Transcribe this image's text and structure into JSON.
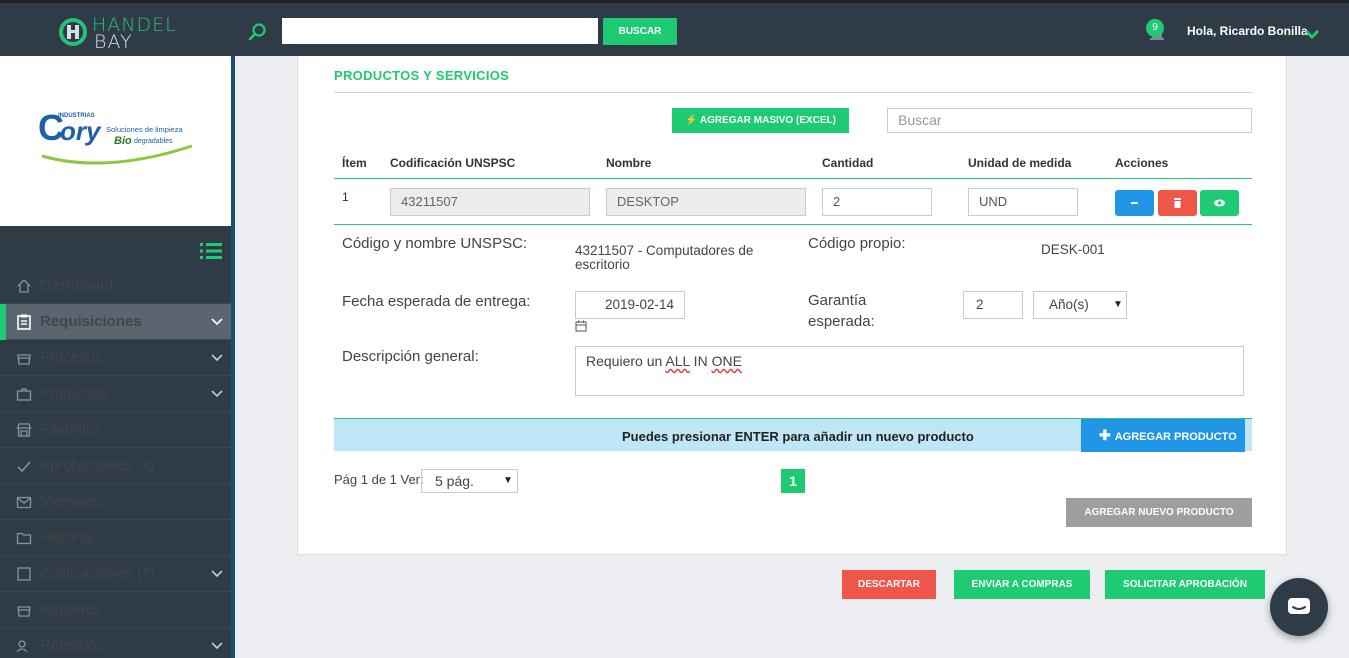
{
  "header": {
    "logo_line1": "HANDEL",
    "logo_line2": "BAY",
    "search_value": "",
    "search_button": "BUSCAR",
    "notification_count": "9",
    "greeting": "Hola, Ricardo Bonilla"
  },
  "company_logo": {
    "word": "ory",
    "letter": "C",
    "top": "INDUSTRIAS",
    "tag1": "Soluciones de limpieza",
    "tag2_a": "Bio",
    "tag2_b": "degradables"
  },
  "sidebar": {
    "items": [
      {
        "label": "Dashboard",
        "icon": "home-icon"
      },
      {
        "label": "Requisiciones",
        "icon": "clipboard-icon",
        "active": true
      },
      {
        "label": "Procesos",
        "icon": "inbox-icon"
      },
      {
        "label": "Productos",
        "icon": "briefcase-icon"
      },
      {
        "label": "Favoritos",
        "icon": "store-icon"
      },
      {
        "label": "Aprobaciones (3)",
        "icon": "check-icon"
      },
      {
        "label": "Mensajes",
        "icon": "envelope-icon"
      },
      {
        "label": "Historial",
        "icon": "folder-icon"
      },
      {
        "label": "Calificaciones (7)",
        "icon": "square-icon"
      },
      {
        "label": "Reportes",
        "icon": "inbox-icon"
      },
      {
        "label": "Referidos",
        "icon": "users-icon"
      }
    ]
  },
  "products": {
    "title": "PRODUCTOS Y SERVICIOS",
    "excel_button": "AGREGAR MASIVO (EXCEL)",
    "search_placeholder": "Buscar",
    "columns": [
      "Ítem",
      "Codificación UNSPSC",
      "Nombre",
      "Cantidad",
      "Unidad de medida",
      "Acciones"
    ],
    "row": {
      "item": "1",
      "unspsc": "43211507",
      "name": "DESKTOP",
      "quantity": "2",
      "unit": "UND"
    },
    "detail": {
      "unspsc_label": "Código y nombre UNSPSC:",
      "unspsc_value_1": "43211507 - Computadores de",
      "unspsc_value_2": "escritorio",
      "own_code_label": "Código propio:",
      "own_code_value": "DESK-001",
      "delivery_label": "Fecha esperada de entrega:",
      "delivery_value": "2019-02-14",
      "warranty_label_1": "Garantía",
      "warranty_label_2": "esperada:",
      "warranty_value": "2",
      "warranty_unit": "Año(s)",
      "description_label": "Descripción general:",
      "description_prefix": "Requiero un ",
      "description_w1": "ALL",
      "description_mid": " IN ",
      "description_w2": "ONE"
    },
    "info_text": "Puedes presionar ENTER para añadir un nuevo producto",
    "add_product_button": "AGREGAR PRODUCTO",
    "pagination_label": "Pág 1 de 1 Ver:",
    "per_page": "5 pág.",
    "current_page": "1",
    "add_new_button": "AGREGAR NUEVO PRODUCTO"
  },
  "footer_actions": {
    "discard": "DESCARTAR",
    "send": "ENVIAR A COMPRAS",
    "approve": "SOLICITAR APROBACIÓN"
  },
  "colors": {
    "accent_green": "#1ecb73",
    "sidebar": "#2f3b47",
    "blue": "#2196e6",
    "red": "#f0554a",
    "info_bg": "#bfe6f6"
  }
}
